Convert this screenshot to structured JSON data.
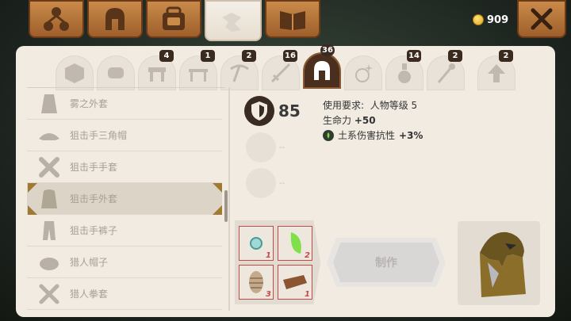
{
  "currency": {
    "amount": "909",
    "icon": "gold-coin-icon"
  },
  "top_tabs": [
    {
      "name": "org-tree-icon",
      "active": false
    },
    {
      "name": "helmet-icon",
      "active": false
    },
    {
      "name": "bag-icon",
      "active": false
    },
    {
      "name": "puzzle-icon",
      "active": true
    },
    {
      "name": "book-icon",
      "active": false
    }
  ],
  "close": {
    "icon": "close-icon"
  },
  "category_tabs": [
    {
      "icon": "cube-icon",
      "badge": ""
    },
    {
      "icon": "scroll-icon",
      "badge": ""
    },
    {
      "icon": "workbench-icon",
      "badge": "4"
    },
    {
      "icon": "table-icon",
      "badge": "1"
    },
    {
      "icon": "pickaxe-icon",
      "badge": "2"
    },
    {
      "icon": "sword-icon",
      "badge": "16"
    },
    {
      "icon": "helmet-icon",
      "badge": "36",
      "active": true
    },
    {
      "icon": "sparkle-ring-icon",
      "badge": ""
    },
    {
      "icon": "potion-icon",
      "badge": "14"
    },
    {
      "icon": "staff-icon",
      "badge": "2"
    },
    {
      "icon": "upgrade-arrow-icon",
      "badge": "2"
    }
  ],
  "items": [
    {
      "name": "雾之外套",
      "selected": false
    },
    {
      "name": "狙击手三角帽",
      "selected": false
    },
    {
      "name": "狙击手手套",
      "selected": false
    },
    {
      "name": "狙击手外套",
      "selected": true
    },
    {
      "name": "狙击手裤子",
      "selected": false
    },
    {
      "name": "猎人帽子",
      "selected": false
    },
    {
      "name": "猎人拳套",
      "selected": false
    }
  ],
  "detail": {
    "armor_value": "85",
    "requirement_label": "使用要求:",
    "requirement_value": "人物等级 5",
    "hp_label": "生命力",
    "hp_value": "+50",
    "resist_label": "土系伤害抗性",
    "resist_value": "+3%",
    "empty_slot_text": "--"
  },
  "recipe": {
    "materials": [
      {
        "icon": "gem-icon",
        "qty": "1"
      },
      {
        "icon": "green-crystal-icon",
        "qty": "2"
      },
      {
        "icon": "pinecone-icon",
        "qty": "3"
      },
      {
        "icon": "wood-plank-icon",
        "qty": "1"
      }
    ],
    "craft_label": "制作"
  },
  "colors": {
    "panel": "#f1ebe2",
    "tab_brown": "#b8773b",
    "active_tab": "#4a2f1e",
    "red": "#c44a4a"
  }
}
